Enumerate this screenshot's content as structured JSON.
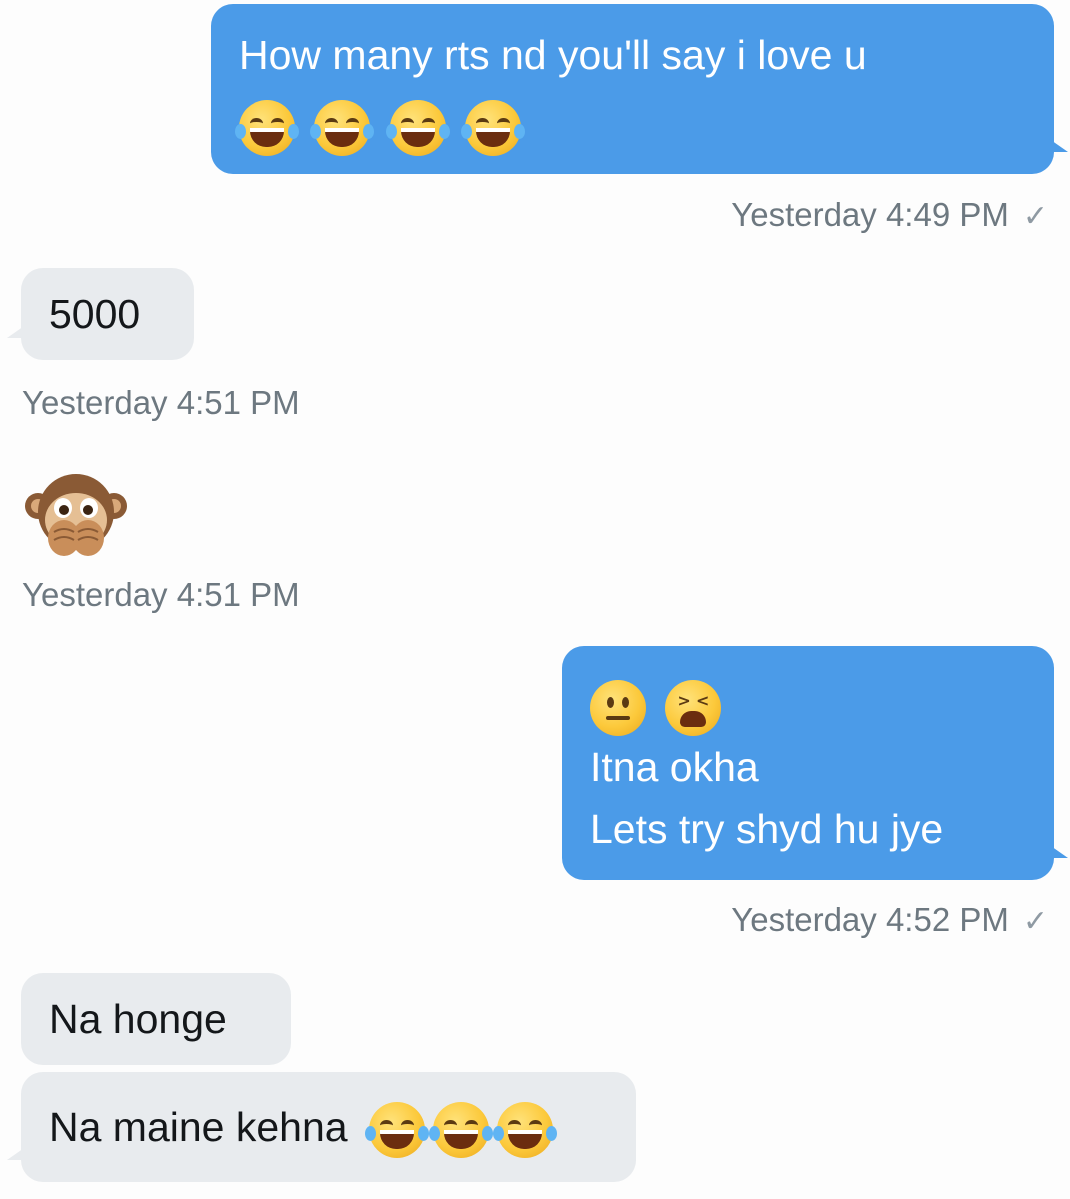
{
  "messages": [
    {
      "direction": "outgoing",
      "lines": [
        "How many rts nd you'll say i love u"
      ],
      "emojis": [
        "face-with-tears-of-joy",
        "face-with-tears-of-joy",
        "face-with-tears-of-joy",
        "face-with-tears-of-joy"
      ],
      "timestamp": "Yesterday 4:49 PM",
      "read_receipt": "✓"
    },
    {
      "direction": "incoming",
      "text": "5000",
      "timestamp": "Yesterday 4:51 PM"
    },
    {
      "direction": "incoming",
      "emoji": "speak-no-evil-monkey",
      "timestamp": "Yesterday 4:51 PM"
    },
    {
      "direction": "outgoing",
      "emojis": [
        "neutral-face",
        "tired-face"
      ],
      "lines": [
        "Itna okha",
        "Lets try shyd hu jye"
      ],
      "timestamp": "Yesterday 4:52 PM",
      "read_receipt": "✓"
    },
    {
      "direction": "incoming",
      "text": "Na honge"
    },
    {
      "direction": "incoming",
      "text": "Na maine kehna",
      "emojis": [
        "face-with-tears-of-joy",
        "face-with-tears-of-joy",
        "face-with-tears-of-joy"
      ]
    }
  ],
  "colors": {
    "outgoing_bubble": "#4b9be8",
    "incoming_bubble": "#e8ebee",
    "timestamp_text": "#6d7880",
    "background": "#fdfdfd"
  }
}
